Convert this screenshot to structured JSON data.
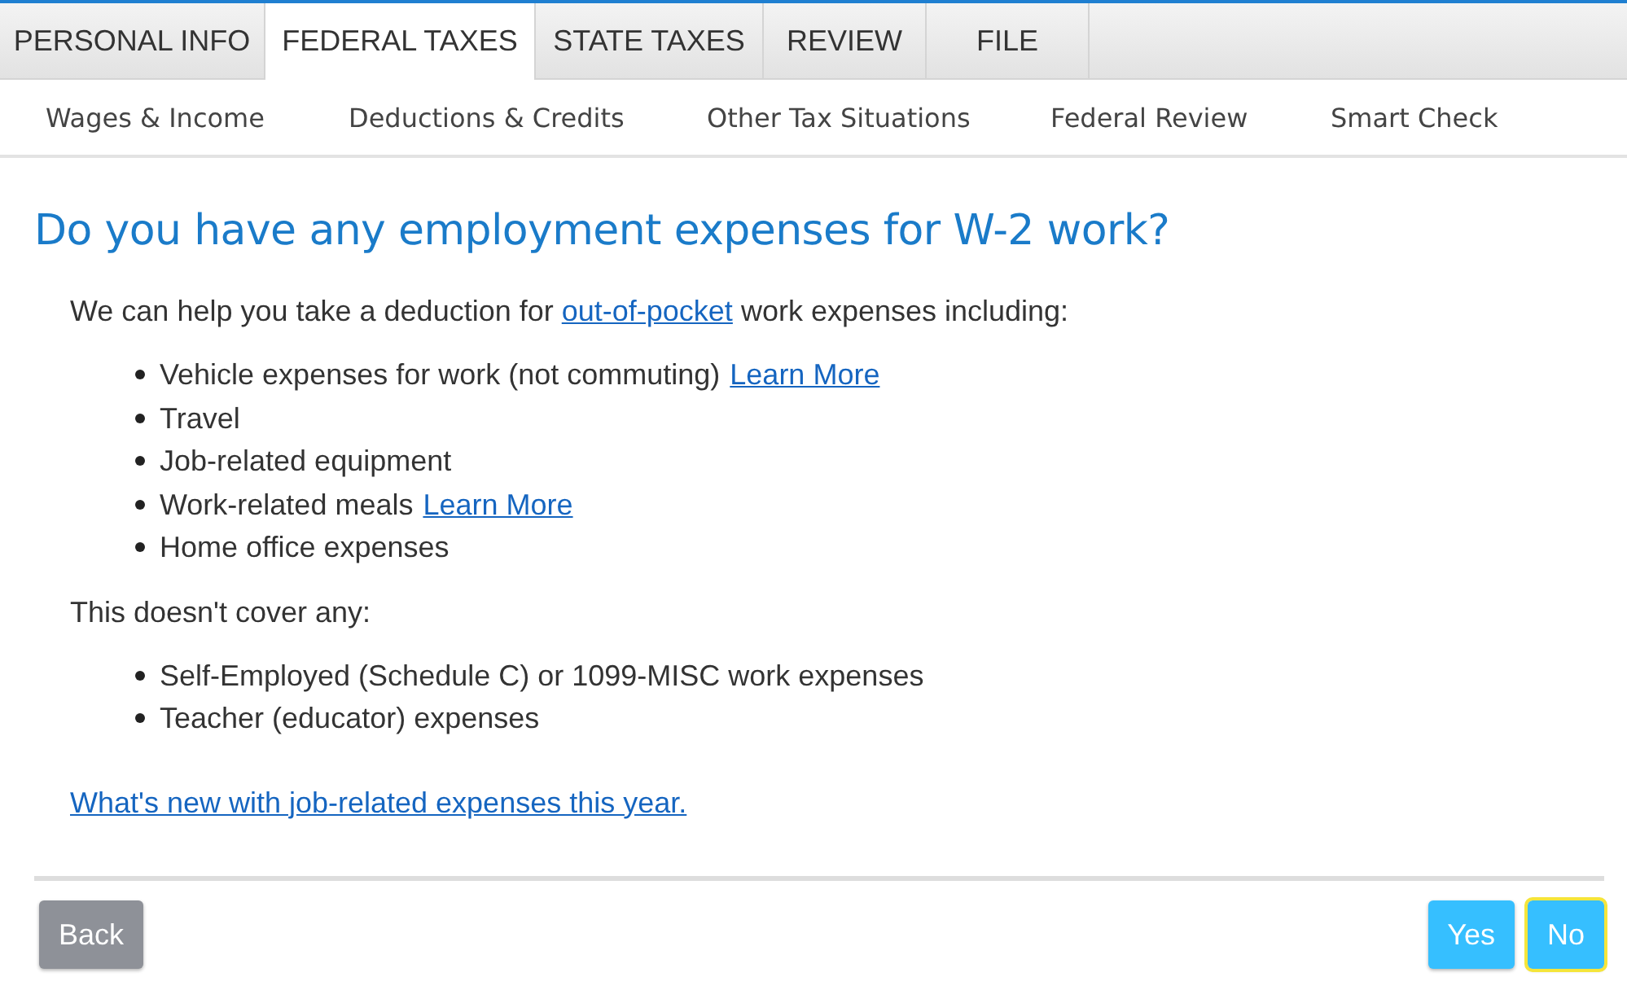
{
  "tabs": [
    {
      "label": "PERSONAL INFO",
      "selected": false
    },
    {
      "label": "FEDERAL TAXES",
      "selected": true
    },
    {
      "label": "STATE TAXES",
      "selected": false
    },
    {
      "label": "REVIEW",
      "selected": false
    },
    {
      "label": "FILE",
      "selected": false
    }
  ],
  "subnav": [
    "Wages & Income",
    "Deductions & Credits",
    "Other Tax Situations",
    "Federal Review",
    "Smart Check"
  ],
  "heading": "Do you have any employment expenses for W-2 work?",
  "intro": {
    "before": "We can help you take a deduction for ",
    "link": "out-of-pocket",
    "after": " work expenses including:"
  },
  "included": [
    {
      "text": "Vehicle expenses for work (not commuting)",
      "link": "Learn More"
    },
    {
      "text": "Travel"
    },
    {
      "text": "Job-related equipment"
    },
    {
      "text": "Work-related meals",
      "link": "Learn More"
    },
    {
      "text": "Home office expenses"
    }
  ],
  "excluded_intro": "This doesn't cover any:",
  "excluded": [
    {
      "text": "Self-Employed (Schedule C) or 1099-MISC work expenses"
    },
    {
      "text": "Teacher (educator) expenses"
    }
  ],
  "news_link": "What's new with job-related expenses this year.",
  "buttons": [
    {
      "label": "Back",
      "kind": "back",
      "focused": false
    },
    {
      "label": "Yes",
      "kind": "answer",
      "focused": false
    },
    {
      "label": "No",
      "kind": "answer",
      "focused": true
    }
  ]
}
